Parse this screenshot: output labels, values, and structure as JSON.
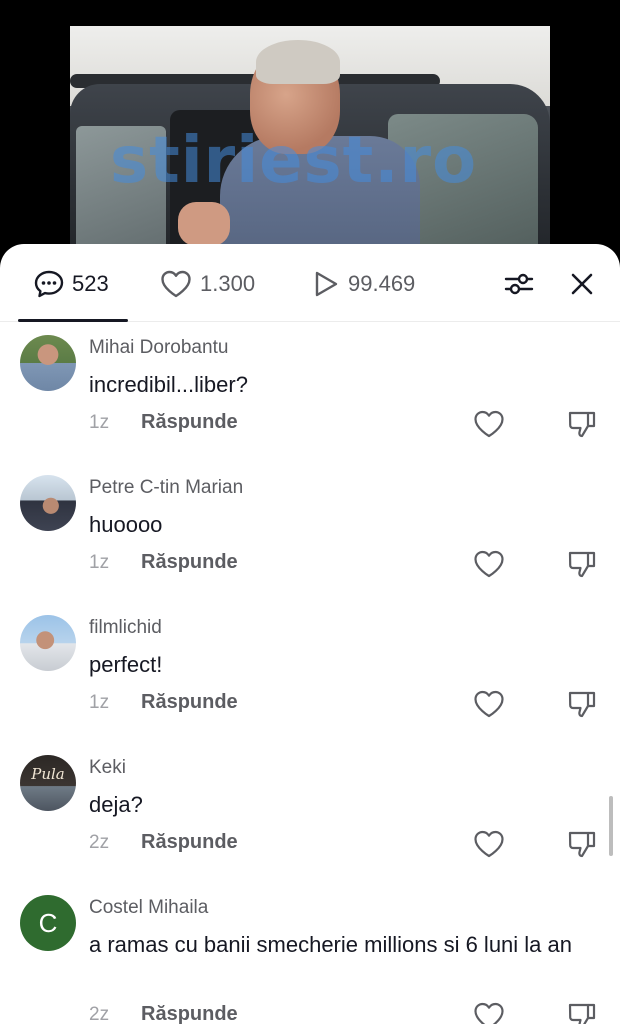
{
  "video": {
    "watermark": "stiriest.ro"
  },
  "tabs": {
    "comments_count": "523",
    "likes_count": "1.300",
    "views_count": "99.469"
  },
  "icons": {
    "comment": "comment-bubble-icon",
    "heart": "heart-icon",
    "play": "play-icon",
    "filter": "filter-sliders-icon",
    "close": "close-icon",
    "dislike": "thumbs-down-icon"
  },
  "colors": {
    "text": "#161823",
    "muted": "#5c5d62",
    "time": "#a0a1a6",
    "avatar_c": "#2f6b2f"
  },
  "comments": [
    {
      "username": "Mihai Dorobantu",
      "text": "incredibil...liber?",
      "time": "1z",
      "reply": "Răspunde"
    },
    {
      "username": "Petre C-tin Marian",
      "text": "huoooo",
      "time": "1z",
      "reply": "Răspunde"
    },
    {
      "username": "filmlichid",
      "text": "perfect!",
      "time": "1z",
      "reply": "Răspunde"
    },
    {
      "username": "Keki",
      "text": "deja?",
      "time": "2z",
      "reply": "Răspunde",
      "avatar_label": "Pula"
    },
    {
      "username": "Costel Mihaila",
      "text": "a ramas cu banii smecherie millions si 6 luni la an",
      "time": "2z",
      "reply": "Răspunde",
      "avatar_letter": "C"
    }
  ]
}
